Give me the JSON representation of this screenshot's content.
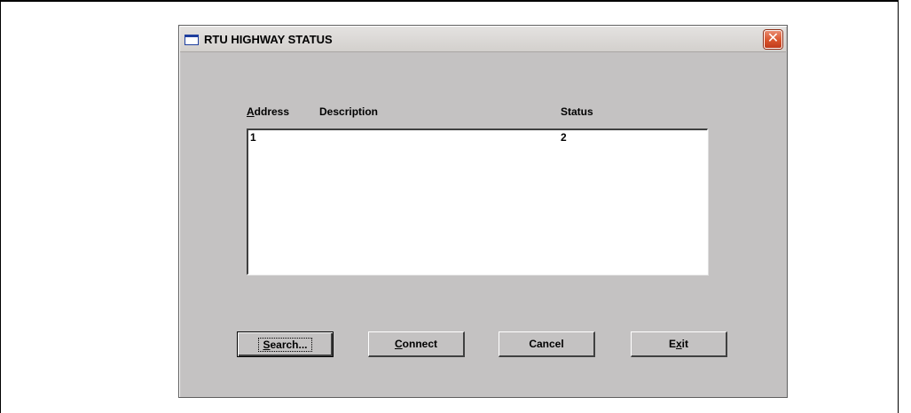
{
  "window": {
    "title": "RTU HIGHWAY STATUS",
    "close_glyph": "✕",
    "icon": "window-icon"
  },
  "list": {
    "columns": {
      "address_accel": "A",
      "address_rest": "ddress",
      "description": "Description",
      "status": "Status"
    },
    "rows": [
      {
        "address": "1",
        "description": "",
        "status": "2"
      }
    ]
  },
  "buttons": {
    "search_accel": "S",
    "search_rest": "earch...",
    "connect_accel": "C",
    "connect_rest": "onnect",
    "cancel": "Cancel",
    "exit_pre": "E",
    "exit_accel": "x",
    "exit_post": "it"
  },
  "colors": {
    "window_face": "#c4c2c2",
    "title_bar": "#d8d5d2",
    "close_button": "#d8542c",
    "list_background": "#ffffff"
  }
}
